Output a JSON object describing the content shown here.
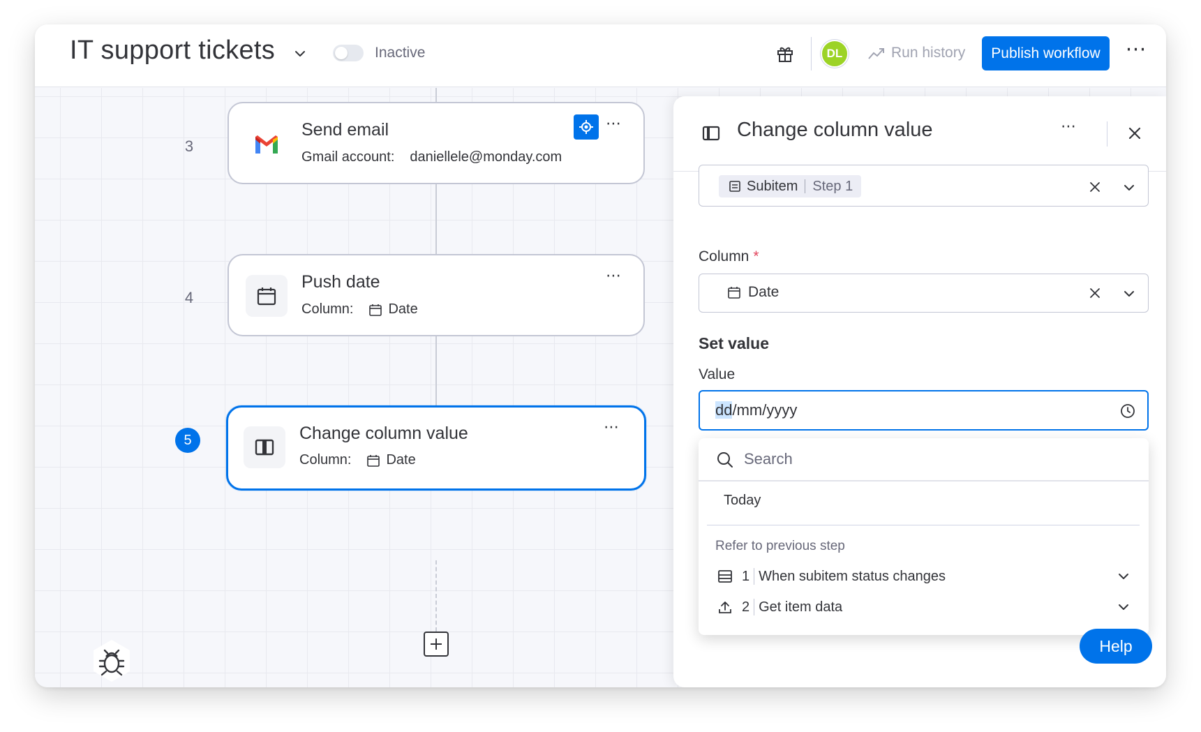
{
  "header": {
    "title": "IT support tickets",
    "status": "Inactive",
    "avatar_initials": "DL",
    "run_history": "Run history",
    "publish": "Publish workflow"
  },
  "colors": {
    "accent": "#0073ea",
    "avatar": "#9cd326",
    "required": "#e2445c"
  },
  "steps": [
    {
      "number": "3",
      "title": "Send email",
      "label": "Gmail account:",
      "value": "daniellele@monday.com",
      "icon": "gmail-icon"
    },
    {
      "number": "4",
      "title": "Push date",
      "label": "Column:",
      "value": "Date",
      "icon": "calendar-icon"
    },
    {
      "number": "5",
      "title": "Change column value",
      "label": "Column:",
      "value": "Date",
      "icon": "column-icon",
      "selected": true
    }
  ],
  "panel": {
    "title": "Change column value",
    "item_field": {
      "chip_label": "Subitem",
      "chip_step": "Step 1"
    },
    "column_label": "Column",
    "required_mark": "*",
    "column_value": "Date",
    "section_title": "Set value",
    "value_label": "Value",
    "value_highlight": "dd",
    "value_rest": "/mm/yyyy"
  },
  "dropdown": {
    "search_placeholder": "Search",
    "today": "Today",
    "group_label": "Refer to previous step",
    "items": [
      {
        "number": "1",
        "label": "When subitem status changes",
        "icon": "list-icon"
      },
      {
        "number": "2",
        "label": "Get item data",
        "icon": "upload-icon"
      }
    ]
  },
  "help": "Help"
}
